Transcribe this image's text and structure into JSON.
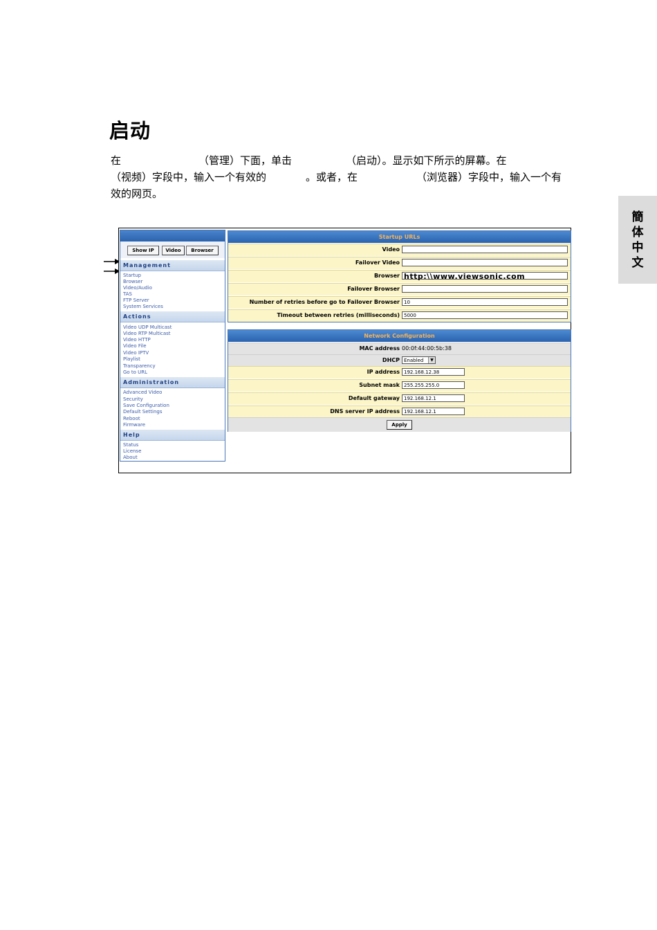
{
  "page": {
    "title": "启动",
    "paragraph": {
      "l1a": "在",
      "l1b": "（管理）下面，单击",
      "l1c": "（启动）。显示如下所示的屏幕。在",
      "l2a": "（视频）字段中，输入一个有效的",
      "l2b": "。或者，在",
      "l2c": "（浏览器）字段中，输入一个有",
      "l3a": "效的网页。"
    },
    "side_tab": [
      "簡",
      "体",
      "中",
      "文"
    ]
  },
  "screenshot": {
    "nav": {
      "buttons": [
        "Show IP",
        "Video",
        "Browser"
      ],
      "sections": [
        {
          "title": "Management",
          "links": [
            "Startup",
            "Browser",
            "Video/Audio",
            "TAS",
            "FTP Server",
            "System Services"
          ]
        },
        {
          "title": "Actions",
          "links": [
            "Video UDP Multicast",
            "Video RTP Multicast",
            "Video HTTP",
            "Video File",
            "Video IPTV",
            "Playlist",
            "Transparency",
            "Go to URL"
          ]
        },
        {
          "title": "Administration",
          "links": [
            "Advanced Video",
            "Security",
            "Save Configuration",
            "Default Settings",
            "Reboot",
            "Firmware"
          ]
        },
        {
          "title": "Help",
          "links": [
            "Status",
            "License",
            "About"
          ]
        }
      ]
    },
    "startup": {
      "header": "Startup URLs",
      "rows": [
        {
          "label": "Video",
          "value": ""
        },
        {
          "label": "Failover Video",
          "value": ""
        },
        {
          "label": "Browser",
          "value": "http:\\\\www.viewsonic.com"
        },
        {
          "label": "Failover Browser",
          "value": ""
        },
        {
          "label": "Number of retries before go to Failover Browser",
          "value": "10"
        },
        {
          "label": "Timeout between retries (milliseconds)",
          "value": "5000"
        }
      ]
    },
    "network": {
      "header": "Network Configuration",
      "mac_label": "MAC address",
      "mac_value": "00:0f:44:00:5b:38",
      "dhcp_label": "DHCP",
      "dhcp_value": "Enabled",
      "rows": [
        {
          "label": "IP address",
          "value": "192.168.12.38"
        },
        {
          "label": "Subnet mask",
          "value": "255.255.255.0"
        },
        {
          "label": "Default gateway",
          "value": "192.168.12.1"
        },
        {
          "label": "DNS server IP address",
          "value": "192.168.12.1"
        }
      ],
      "apply_label": "Apply"
    }
  }
}
